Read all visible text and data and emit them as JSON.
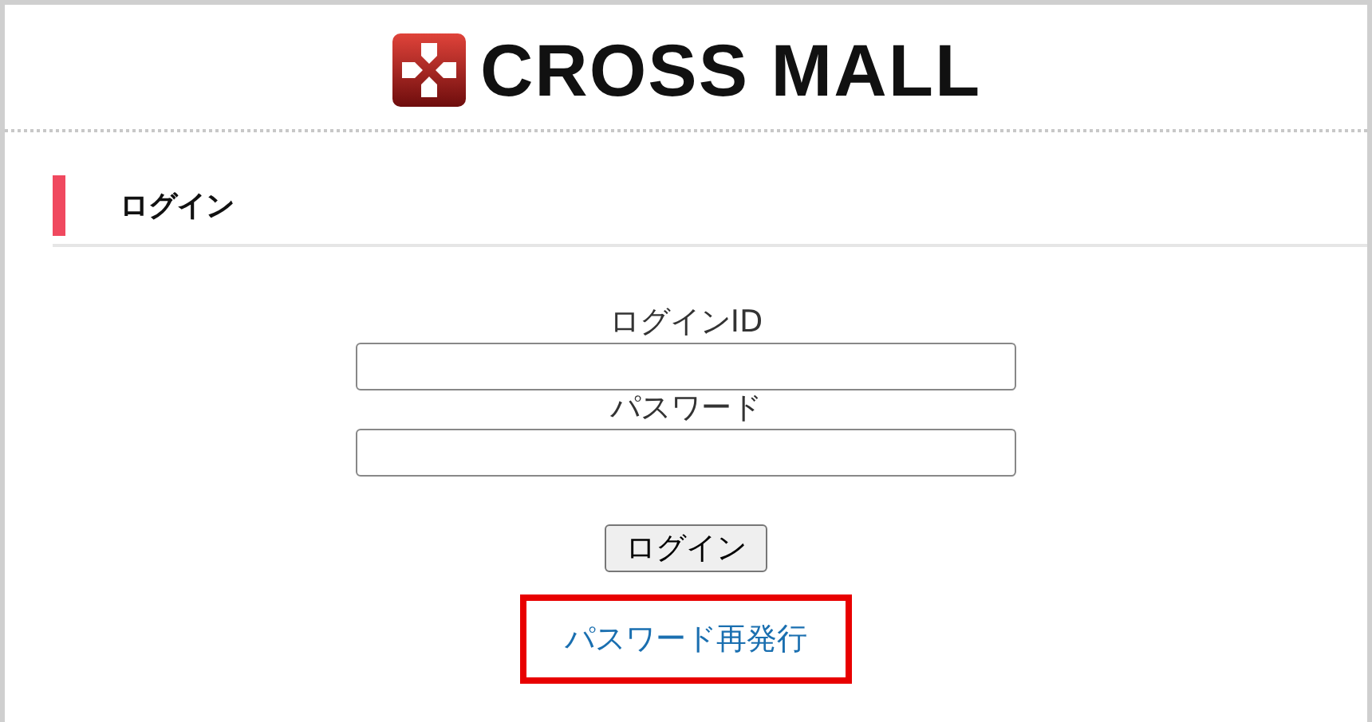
{
  "logo": {
    "text": "CROSS MALL"
  },
  "section": {
    "title": "ログイン"
  },
  "fields": [
    {
      "label": "ログインID"
    },
    {
      "label": "パスワード"
    }
  ],
  "submit": {
    "label": "ログイン"
  },
  "reset_link": {
    "text": "パスワード再発行",
    "highlighted": true
  }
}
